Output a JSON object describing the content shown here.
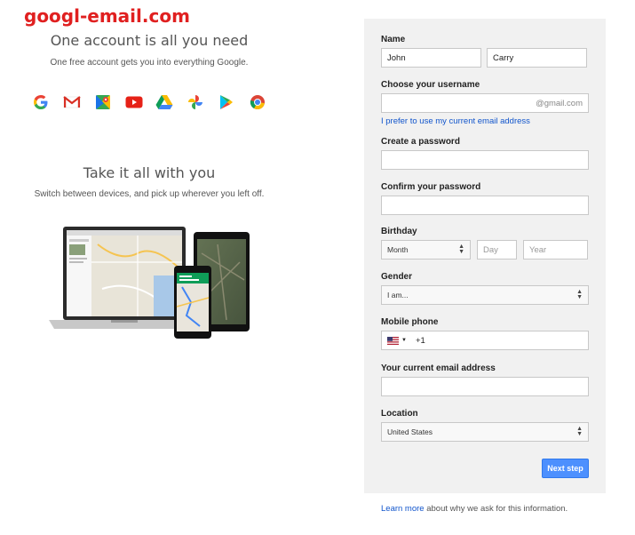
{
  "watermark": "googl-email.com",
  "promo": {
    "title": "One account is all you need",
    "subtitle": "One free account gets you into everything Google.",
    "title2": "Take it all with you",
    "subtitle2": "Switch between devices, and pick up wherever you left off.",
    "app_icons": [
      "google-icon",
      "gmail-icon",
      "maps-icon",
      "youtube-icon",
      "drive-icon",
      "photos-icon",
      "play-icon",
      "chrome-icon"
    ]
  },
  "form": {
    "name_label": "Name",
    "first_name": "John",
    "last_name": "Carry",
    "username_label": "Choose your username",
    "username_suffix": "@gmail.com",
    "use_current_email_link": "I prefer to use my current email address",
    "password_label": "Create a password",
    "confirm_label": "Confirm your password",
    "birthday_label": "Birthday",
    "month_value": "Month",
    "day_placeholder": "Day",
    "year_placeholder": "Year",
    "gender_label": "Gender",
    "gender_value": "I am...",
    "phone_label": "Mobile phone",
    "phone_code": "+1",
    "current_email_label": "Your current email address",
    "location_label": "Location",
    "location_value": "United States",
    "next_button": "Next step"
  },
  "footer": {
    "learn_more": "Learn more",
    "text": "about why we ask for this information."
  },
  "colors": {
    "brand_red": "#e02020",
    "button_blue": "#4d90fe",
    "link_blue": "#1155cc"
  }
}
